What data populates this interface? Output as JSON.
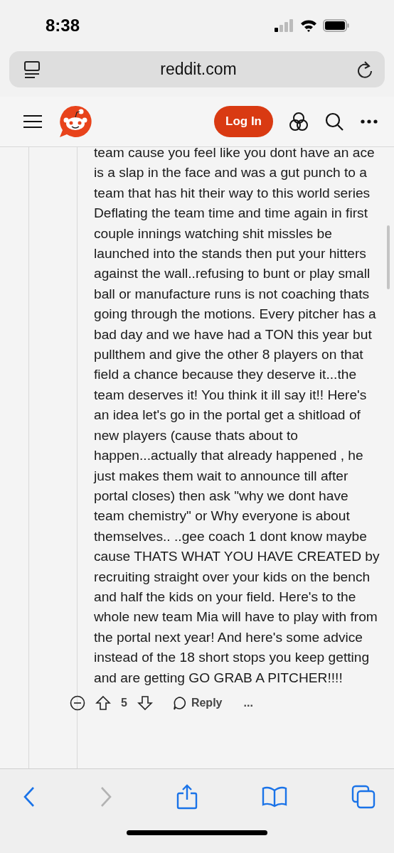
{
  "status_bar": {
    "time": "8:38"
  },
  "address_bar": {
    "url": "reddit.com"
  },
  "site_header": {
    "login_button": "Log In"
  },
  "comment": {
    "body": "team cause you feel like you dont have an ace is a slap in the face and was a gut punch to a team that has hit their way to this world series Deflating the team time and time again in first couple innings watching shit missles be launched into the stands then put your hitters against the wall..refusing to bunt or play small ball or manufacture runs is not coaching thats going through the motions. Every pitcher has a bad day and we have had a TON this year but pullthem and give the other 8 players on that field a chance because they deserve it...the team deserves it! You think it ill say it!! Here's an idea let's go in the portal get a shitload of new players (cause thats about to happen...actually that already happened , he just makes them wait to announce till after portal closes) then ask \"why we dont have team chemistry\" or Why everyone is about themselves.. ..gee coach 1 dont know maybe cause THATS WHAT YOU HAVE CREATED by recruiting straight over your kids on the bench and half the kids on your field. Here's to the whole new team Mia will have to play with from the portal next year! And here's some advice instead of the 18 short stops you keep getting and are getting GO GRAB A PITCHER!!!!",
    "score": "5",
    "reply_label": "Reply",
    "more_label": "..."
  },
  "toolbar": {
    "back_disabled": false,
    "forward_disabled": true
  }
}
